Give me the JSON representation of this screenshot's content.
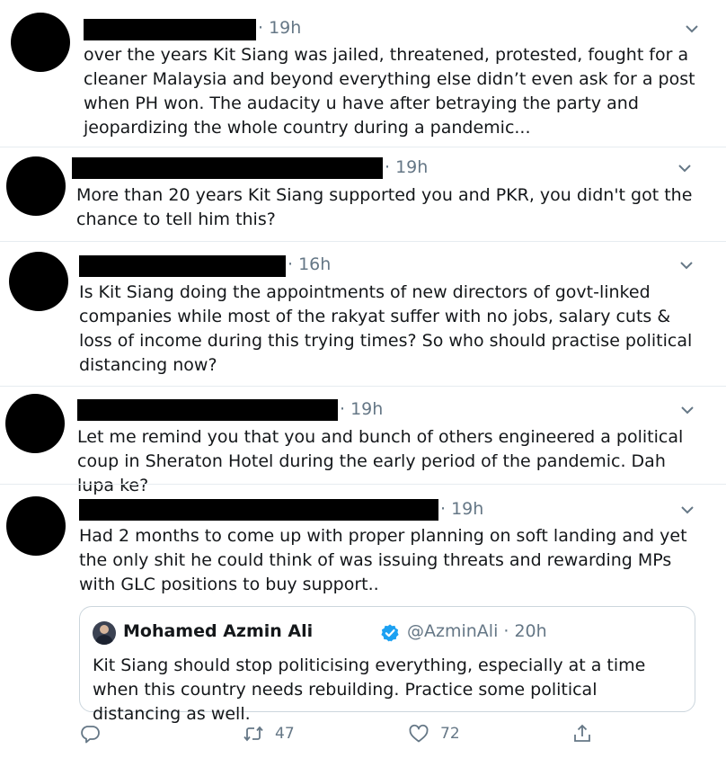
{
  "replies": [
    {
      "time": "· 19h",
      "text": "over the years Kit Siang was jailed, threatened, protested, fought for a cleaner Malaysia and beyond everything else didn’t even ask for a post when PH won. The audacity u have after betraying the party and jeopardizing the whole country during a pandemic..."
    },
    {
      "time": "· 19h",
      "text": "More than 20 years Kit Siang supported you and PKR, you didn't got the chance to tell him this?"
    },
    {
      "time": "· 16h",
      "text": "Is Kit Siang doing the appointments of new directors of govt-linked companies while most of the rakyat suffer with no jobs, salary cuts & loss of income during this trying times? So who should practise political distancing now?"
    },
    {
      "time": "· 19h",
      "text": "Let me remind you that you and bunch of others engineered a political coup in Sheraton Hotel during the early period of the pandemic. Dah lupa ke?"
    },
    {
      "time": "· 19h",
      "text": "Had 2 months to come up with proper planning on soft landing and yet the only shit he could think of was issuing threats and rewarding MPs with GLC positions to buy support.."
    }
  ],
  "quoted_tweet": {
    "name": "Mohamed Azmin Ali",
    "handle": "@AzminAli · 20h",
    "text": "Kit Siang should stop politicising everything, especially at a time when this country needs rebuilding. Practice some political distancing as well."
  },
  "actions": {
    "retweets": "47",
    "likes": "72"
  },
  "colors": {
    "text": "#14171a",
    "secondary": "#657786",
    "border": "#e6ecf0",
    "verified": "#1da1f2"
  },
  "icons": [
    "chevron-down-icon",
    "reply-icon",
    "retweet-icon",
    "like-icon",
    "share-icon",
    "verified-icon"
  ]
}
